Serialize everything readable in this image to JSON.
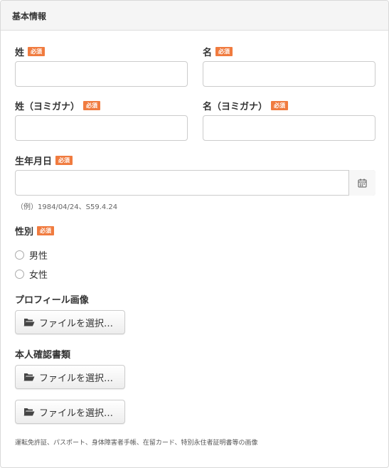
{
  "panel": {
    "title": "基本情報"
  },
  "required_badge": "必須",
  "fields": {
    "last_name": {
      "label": "姓",
      "value": ""
    },
    "first_name": {
      "label": "名",
      "value": ""
    },
    "last_name_kana": {
      "label": "姓（ヨミガナ）",
      "value": ""
    },
    "first_name_kana": {
      "label": "名（ヨミガナ）",
      "value": ""
    },
    "birthdate": {
      "label": "生年月日",
      "value": "",
      "hint": "（例）1984/04/24、S59.4.24",
      "button_icon": "calendar-icon"
    },
    "gender": {
      "label": "性別",
      "options": [
        "男性",
        "女性"
      ],
      "selected": ""
    },
    "profile_image": {
      "label": "プロフィール画像",
      "button_label": "ファイルを選択…",
      "button_icon": "folder-open-icon"
    },
    "id_documents": {
      "label": "本人確認書類",
      "button_label_1": "ファイルを選択…",
      "button_label_2": "ファイルを選択…",
      "button_icon": "folder-open-icon",
      "note": "運転免許証、パスポート、身体障害者手帳、在留カード、特別永住者証明書等の画像"
    }
  },
  "colors": {
    "badge": "#f07b3f",
    "border": "#cccccc",
    "header_bg": "#f5f5f5",
    "text": "#333333"
  }
}
